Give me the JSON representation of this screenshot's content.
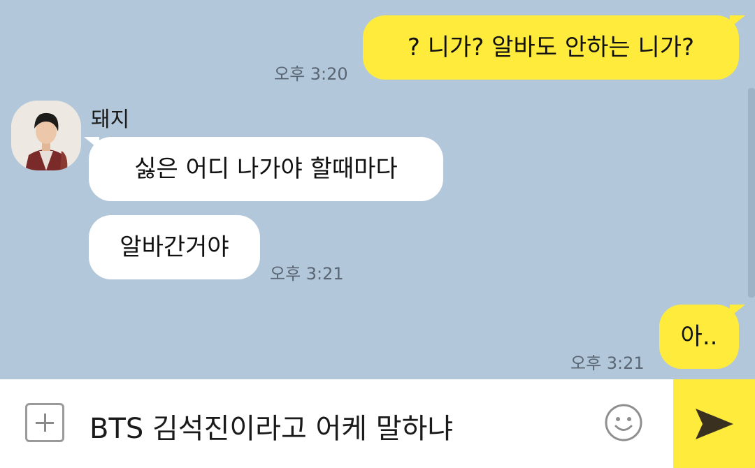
{
  "chat": {
    "messages": [
      {
        "direction": "out",
        "text": "? 니가? 알바도 안하는 니가?",
        "time": "오후 3:20"
      },
      {
        "direction": "in",
        "text": "싫은 어디 나가야 할때마다",
        "time": ""
      },
      {
        "direction": "in",
        "text": "알바간거야",
        "time": "오후 3:21"
      },
      {
        "direction": "out",
        "text": "아..",
        "time": "오후 3:21"
      }
    ],
    "sender_name": "돼지"
  },
  "input": {
    "value": "BTS 김석진이라고 어케 말하냐"
  },
  "icons": {
    "attach": "plus-square-icon",
    "emoji": "smiley-icon",
    "send": "send-arrow-icon"
  },
  "colors": {
    "background": "#b2c7da",
    "outgoing_bubble": "#ffeb3b",
    "incoming_bubble": "#ffffff",
    "send_button": "#ffeb3b"
  }
}
